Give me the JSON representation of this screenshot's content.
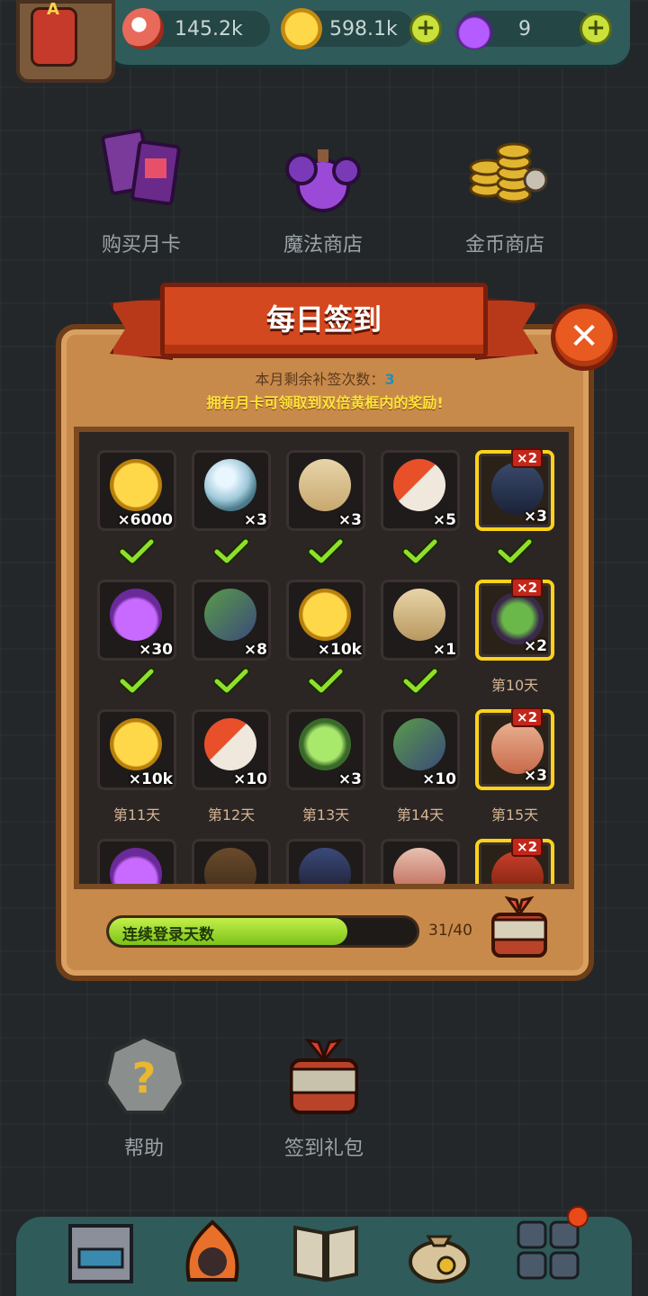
{
  "resources": {
    "eye": {
      "value": "145.2k",
      "icon": "eyeball-icon"
    },
    "coins": {
      "value": "598.1k",
      "icon": "coin-icon"
    },
    "potions": {
      "value": "9",
      "icon": "potion-icon"
    },
    "plus_label": "+"
  },
  "avatar_letter": "A",
  "shops": [
    {
      "label": "购买月卡",
      "icon": "monthly-card-icon"
    },
    {
      "label": "魔法商店",
      "icon": "magic-potion-shop-icon"
    },
    {
      "label": "金币商店",
      "icon": "gold-coin-shop-icon"
    }
  ],
  "dialog": {
    "title": "每日签到",
    "close_label": "✕",
    "remain_text": "本月剩余补签次数：",
    "remain_count": "3",
    "note": "拥有月卡可领取到双倍黄框内的奖励!",
    "double_badge": "×2",
    "rows": [
      [
        {
          "icon": "gold-coin",
          "qty": "×6000",
          "status": "claimed"
        },
        {
          "icon": "crystal-orb",
          "qty": "×3",
          "status": "claimed"
        },
        {
          "icon": "treasure-map",
          "qty": "×3",
          "status": "claimed"
        },
        {
          "icon": "capsule-scroll",
          "qty": "×5",
          "status": "claimed"
        },
        {
          "icon": "hero-card",
          "qty": "×3",
          "status": "claimed",
          "double": true
        }
      ],
      [
        {
          "icon": "purple-potion",
          "qty": "×30",
          "status": "claimed"
        },
        {
          "icon": "equipment-card",
          "qty": "×8",
          "status": "claimed"
        },
        {
          "icon": "gold-coin",
          "qty": "×10k",
          "status": "claimed"
        },
        {
          "icon": "monster-ticket",
          "qty": "×1",
          "status": "claimed"
        },
        {
          "icon": "monster-pot",
          "qty": "×2",
          "status": "day",
          "day": "第10天",
          "double": true
        }
      ],
      [
        {
          "icon": "gold-coin",
          "qty": "×10k",
          "status": "day",
          "day": "第11天"
        },
        {
          "icon": "capsule-scroll",
          "qty": "×10",
          "status": "day",
          "day": "第12天"
        },
        {
          "icon": "green-flame-skull",
          "qty": "×3",
          "status": "day",
          "day": "第13天"
        },
        {
          "icon": "equipment-card",
          "qty": "×10",
          "status": "day",
          "day": "第14天"
        },
        {
          "icon": "ancient-scroll",
          "qty": "×3",
          "status": "day",
          "day": "第15天",
          "double": true
        }
      ],
      [
        {
          "icon": "purple-potion",
          "qty": "",
          "status": "hidden"
        },
        {
          "icon": "feather-bundle",
          "qty": "",
          "status": "hidden"
        },
        {
          "icon": "dark-card",
          "qty": "",
          "status": "hidden"
        },
        {
          "icon": "rune-scroll",
          "qty": "",
          "status": "hidden"
        },
        {
          "icon": "red-chest",
          "qty": "",
          "status": "hidden",
          "double": true
        }
      ]
    ],
    "progress": {
      "label": "连续登录天数",
      "count": "31/40",
      "fraction": 0.775
    }
  },
  "lower": {
    "help_label": "帮助",
    "pack_label": "签到礼包"
  },
  "nav": [
    "shop-building-icon",
    "fire-monster-icon",
    "book-icon",
    "money-bag-icon",
    "inventory-grid-icon"
  ]
}
